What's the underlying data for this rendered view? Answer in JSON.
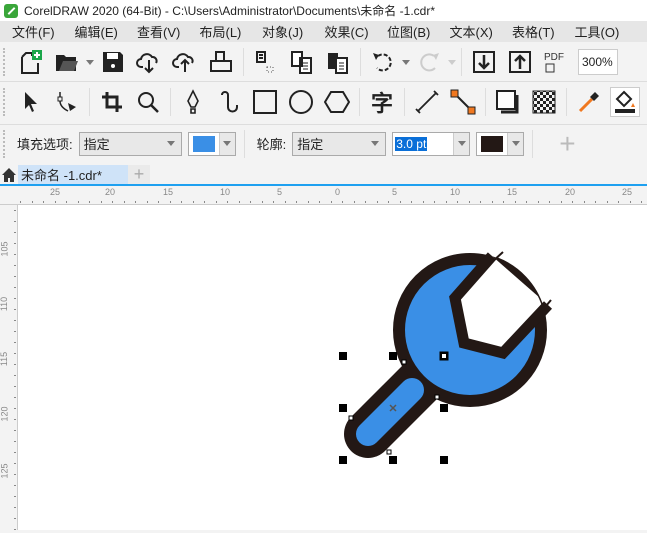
{
  "window": {
    "title": "CorelDRAW 2020 (64-Bit) - C:\\Users\\Administrator\\Documents\\未命名 -1.cdr*"
  },
  "menu": [
    "文件(F)",
    "编辑(E)",
    "查看(V)",
    "布局(L)",
    "对象(J)",
    "效果(C)",
    "位图(B)",
    "文本(X)",
    "表格(T)",
    "工具(O)"
  ],
  "toolbar": {
    "zoom": "300%",
    "pdf_label": "PDF"
  },
  "toolbox": {
    "text_tool_glyph": "字"
  },
  "propbar": {
    "fill_label": "填充选项:",
    "fill_mode": "指定",
    "fill_color": "#3a8fe6",
    "outline_label": "轮廓:",
    "outline_mode": "指定",
    "outline_width": "3.0 pt",
    "outline_color": "#231815"
  },
  "tabs": {
    "document": "未命名 -1.cdr*",
    "add": "+"
  },
  "rulers": {
    "horizontal": [
      "25",
      "20",
      "15",
      "10",
      "5",
      "0",
      "5",
      "10",
      "15",
      "20",
      "25"
    ],
    "vertical": [
      "105",
      "110",
      "115",
      "120",
      "125"
    ]
  },
  "colors": {
    "wrench_fill": "#3a8fe6",
    "wrench_outline": "#231815",
    "accent": "#1ea0f0"
  }
}
